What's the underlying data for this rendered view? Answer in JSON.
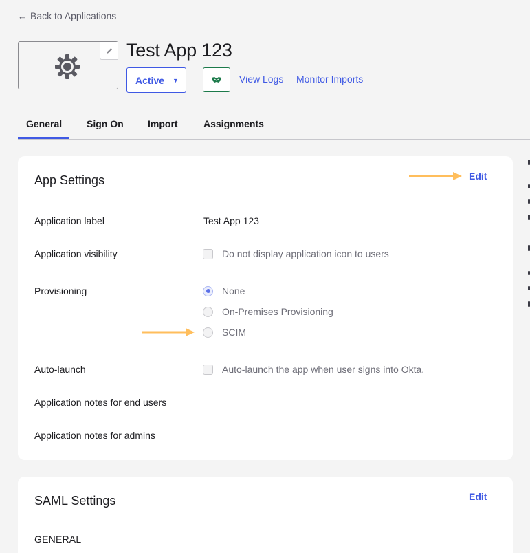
{
  "nav": {
    "back_label": "Back to Applications"
  },
  "app": {
    "title": "Test App 123",
    "status_label": "Active",
    "view_logs_label": "View Logs",
    "monitor_imports_label": "Monitor Imports"
  },
  "tabs": [
    {
      "label": "General",
      "active": true
    },
    {
      "label": "Sign On",
      "active": false
    },
    {
      "label": "Import",
      "active": false
    },
    {
      "label": "Assignments",
      "active": false
    }
  ],
  "app_settings": {
    "title": "App Settings",
    "edit_label": "Edit",
    "fields": {
      "app_label": {
        "label": "Application label",
        "value": "Test App 123"
      },
      "visibility": {
        "label": "Application visibility",
        "option": "Do not display application icon to users",
        "checked": false
      },
      "provisioning": {
        "label": "Provisioning",
        "options": [
          {
            "label": "None",
            "selected": true
          },
          {
            "label": "On-Premises Provisioning",
            "selected": false
          },
          {
            "label": "SCIM",
            "selected": false
          }
        ]
      },
      "auto_launch": {
        "label": "Auto-launch",
        "option": "Auto-launch the app when user signs into Okta.",
        "checked": false
      },
      "notes_end_users": {
        "label": "Application notes for end users"
      },
      "notes_admins": {
        "label": "Application notes for admins"
      }
    }
  },
  "saml_settings": {
    "title": "SAML Settings",
    "edit_label": "Edit",
    "section_label": "GENERAL"
  },
  "colors": {
    "accent": "#3f59e4",
    "annotation_arrow": "#ffbe5c",
    "handshake_green": "#1c7a4a"
  },
  "icons": {
    "back": "arrow-left-icon",
    "logo": "gear-icon",
    "logo_edit": "pencil-icon",
    "status_caret": "caret-down-icon",
    "handshake": "handshake-icon"
  }
}
